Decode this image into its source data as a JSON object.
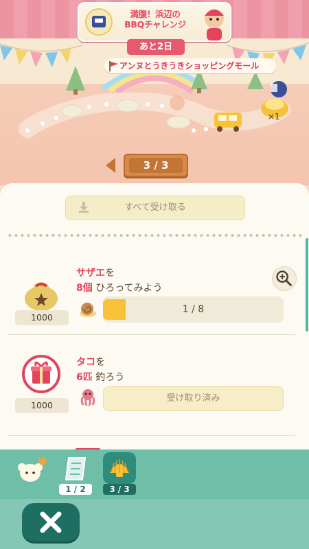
{
  "event": {
    "title_line1": "満腹！浜辺の",
    "title_line2": "BBQチャレンジ",
    "days_left": "あと2日",
    "location": "アンヌとうきうきショッピングモール"
  },
  "map": {
    "multiplier": "×1",
    "page_indicator": "3 / 3"
  },
  "panel": {
    "receive_all_label": "すべて受け取る"
  },
  "tasks": [
    {
      "reward_amount": "1000",
      "item": "サザエ",
      "line1_suffix": "を",
      "count": "8個",
      "line2_suffix": " ひろってみよう",
      "progress_text": "1 / 8",
      "progress_fraction": 0.125,
      "reward_icon": "leaf-ticket-bag-icon",
      "task_icon": "snail-icon"
    },
    {
      "reward_amount": "1000",
      "item": "タコ",
      "line1_suffix": "を",
      "count": "6匹",
      "line2_suffix": " 釣ろう",
      "status_text": "受け取り済み",
      "reward_icon": "gift-icon",
      "task_icon": "octopus-icon"
    }
  ],
  "tabs": [
    {
      "count": "1 / 2",
      "icon": "map-icon"
    },
    {
      "count": "3 / 3",
      "icon": "shell-icon",
      "active": true
    }
  ],
  "colors": {
    "accent_red": "#e2445c",
    "teal": "#2f8b7b",
    "progress_fill": "#f7c23a"
  }
}
